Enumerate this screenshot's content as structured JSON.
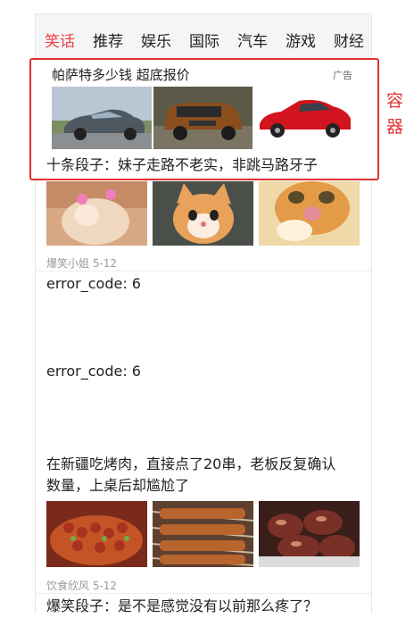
{
  "tabs": [
    "笑话",
    "推荐",
    "娱乐",
    "国际",
    "汽车",
    "游戏",
    "财经"
  ],
  "active_tab": "笑话",
  "ad": {
    "title": "帕萨特多少钱 超底报价",
    "tag": "广告",
    "caption": "十条段子：妹子走路不老实，非跳马路牙子",
    "images": [
      "sedan-car-photo",
      "suv-car-photo",
      "red-car-photo"
    ]
  },
  "annotation": {
    "line1": "容",
    "line2": "器"
  },
  "feed": {
    "item1_images": [
      "kitten-photo-1",
      "kitten-photo-2",
      "kitten-photo-3"
    ],
    "item1_source": "爆笑小姐 5-12",
    "error1": "error_code: 6",
    "error2": "error_code: 6",
    "item2_title_line1": "在新疆吃烤肉，直接点了20串，老板反复确认",
    "item2_title_line2": "数量，上桌后却尴尬了",
    "item2_images": [
      "kebab-photo-1",
      "kebab-photo-2",
      "kebab-photo-3"
    ],
    "item2_source": "饮食欣风 5-12",
    "item3_title": "爆笑段子：是不是感觉没有以前那么疼了？"
  }
}
